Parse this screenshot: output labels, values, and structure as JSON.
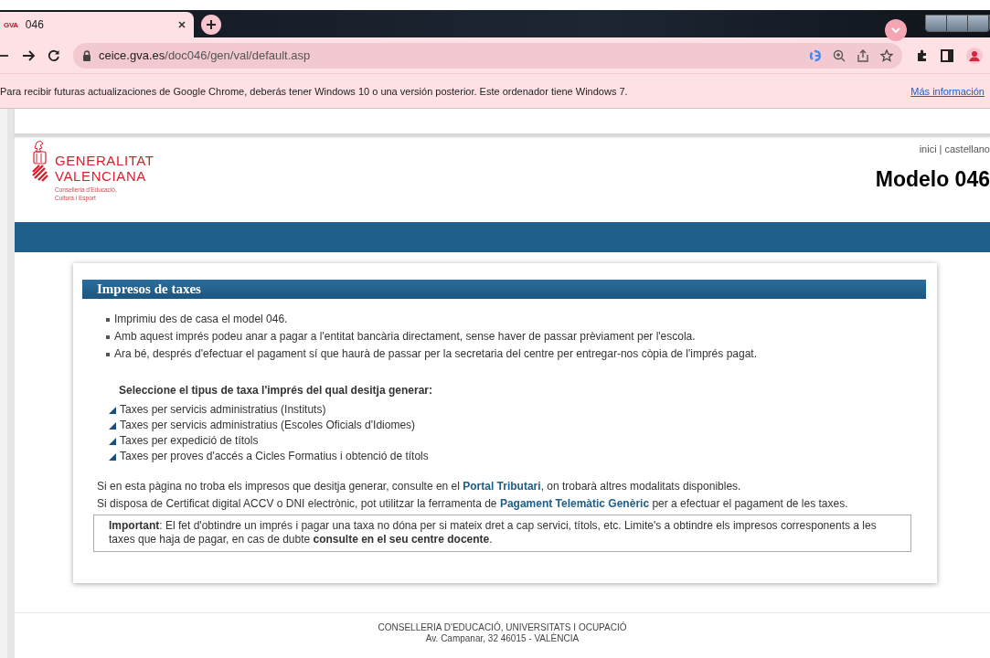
{
  "browser": {
    "tab": {
      "favicon": "GVA",
      "title": "046"
    },
    "url": {
      "host": "ceice.gva.es",
      "path": "/doc046/gen/val/default.asp"
    },
    "infobar": {
      "message": "Para recibir futuras actualizaciones de Google Chrome, deberás tener Windows 10 o una versión posterior. Este ordenador tiene Windows 7.",
      "link": "Más información"
    }
  },
  "header": {
    "logo": {
      "line1": "GENERALITAT",
      "line2": "VALENCIANA",
      "sub1": "Conselleria d'Educació,",
      "sub2": "Cultura i Esport"
    },
    "nav_links": [
      {
        "label": "inici"
      },
      {
        "label": "castellano"
      }
    ],
    "nav_separator": "|",
    "title": "Modelo 046"
  },
  "card": {
    "title": "Impresos de taxes",
    "bullets": [
      "Imprimiu des de casa el model 046.",
      "Amb aquest imprés podeu anar a pagar a l'entitat bancària directament, sense haver de passar prèviament per l'escola.",
      "Ara bé, després d'efectuar el pagament sí que haurà de passar per la secretaria del centre per entregar-nos còpia de l'imprés pagat."
    ],
    "prompt": "Seleccione el tipus de taxa l'imprés del qual desitja generar:",
    "tax_links": [
      "Taxes per servicis administratius (Instituts)",
      "Taxes per servicis administratius (Escoles Oficials d'Idiomes)",
      "Taxes per expedició de títols",
      "Taxes per proves d'accés a Cicles Formatius i obtenció de títols"
    ],
    "notes": [
      {
        "before": "Si en esta pàgina no troba els impresos que desitja generar, consulte en el",
        "link": "Portal Tributari",
        "after": ", on trobarà altres modalitats disponibles."
      },
      {
        "before": "Si disposa de Certificat digital ACCV o DNI electrònic, pot utilitzar la ferramenta de",
        "link": "Pagament Telemàtic Genèric",
        "after": "per a efectuar el pagament de les taxes."
      }
    ],
    "important": "**Important**: El fet d'obtindre un imprés i pagar una taxa no dóna per si mateix dret a cap servici, títols, etc. Limite's a obtindre els impresos corresponents a les taxes que haja de pagar, en cas de dubte **consulte en el seu centre docente**."
  },
  "footer": [
    "CONSELLERIA D'EDUCACIÓ, UNIVERSITATS I OCUPACIÓ",
    "Av. Campanar, 32 46015 - VALÈNCIA"
  ]
}
